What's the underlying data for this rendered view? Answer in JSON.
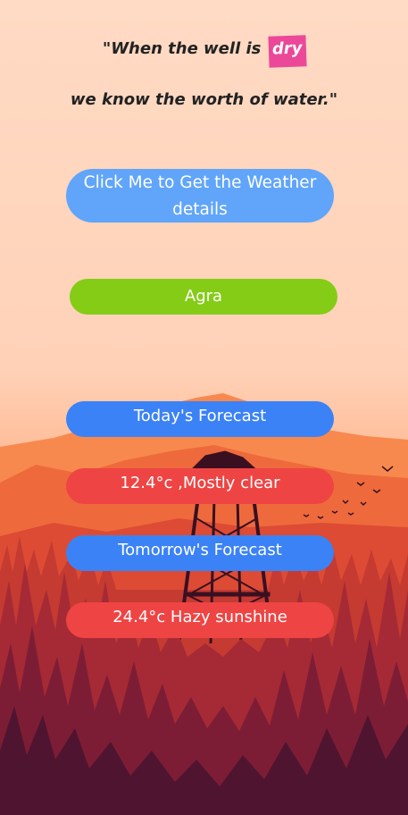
{
  "quote": {
    "line1_prefix": "\"When the well is ",
    "line1_highlight": "dry",
    "line2": "we know the worth of water.\""
  },
  "weather_button": {
    "label": "Click Me to Get the Weather details"
  },
  "location": {
    "city": "Agra"
  },
  "forecast": {
    "today_label": "Today's Forecast",
    "today_value": "12.4°c ,Mostly clear",
    "tomorrow_label": "Tomorrow's Forecast",
    "tomorrow_value": "24.4°c Hazy sunshine"
  },
  "colors": {
    "background": "#ffdac4",
    "highlight": "#ec4899",
    "weather_button": "#60a5fa",
    "city_pill": "#84cc16",
    "forecast_label": "#3b82f6",
    "forecast_value": "#ef4444"
  }
}
